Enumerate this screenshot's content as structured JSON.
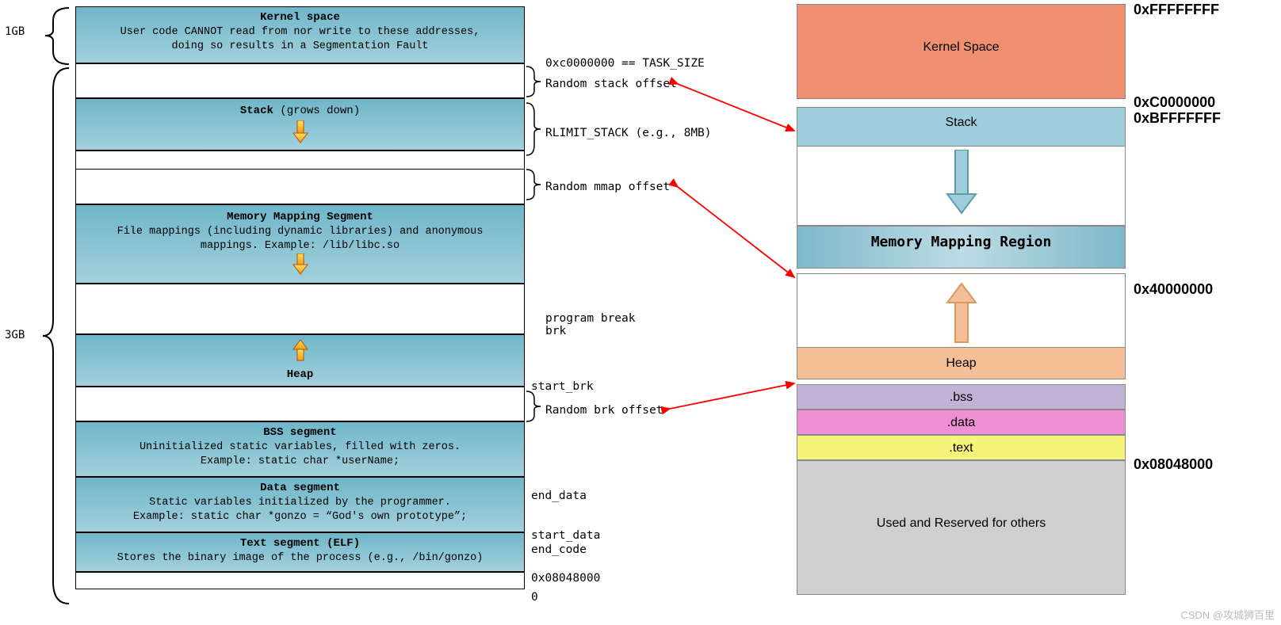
{
  "left": {
    "size_1gb": "1GB",
    "size_3gb": "3GB",
    "kernel": {
      "title": "Kernel space",
      "sub": "User code CANNOT read from nor write to these addresses,\ndoing so results in a Segmentation Fault"
    },
    "stack": {
      "title": "Stack",
      "grows": " (grows down)"
    },
    "mmap": {
      "title": "Memory Mapping Segment",
      "sub": "File mappings (including dynamic libraries) and anonymous\nmappings. Example: /lib/libc.so"
    },
    "heap": {
      "title": "Heap"
    },
    "bss": {
      "title": "BSS segment",
      "sub": "Uninitialized static variables, filled with zeros.\nExample: static char *userName;"
    },
    "data": {
      "title": "Data segment",
      "sub": "Static variables initialized by the programmer.\nExample: static char *gonzo = “God's own prototype”;"
    },
    "text": {
      "title": "Text segment (ELF)",
      "sub": "Stores the binary image of the process (e.g., /bin/gonzo)"
    },
    "annot": {
      "task_size": "0xc0000000 == TASK_SIZE",
      "rand_stack": "Random stack offset",
      "rlimit": "RLIMIT_STACK (e.g., 8MB)",
      "rand_mmap": "Random mmap offset",
      "prog_break": "program break\nbrk",
      "start_brk": "start_brk",
      "rand_brk": "Random brk offset",
      "end_data": "end_data",
      "start_data": "start_data",
      "end_code": "end_code",
      "addr_text": "0x08048000",
      "zero": "0"
    }
  },
  "right": {
    "kernel": "Kernel Space",
    "stack": "Stack",
    "mmap": "Memory Mapping Region",
    "heap": "Heap",
    "bss": ".bss",
    "data": ".data",
    "text": ".text",
    "reserved": "Used and Reserved for others",
    "addr": {
      "ffff": "0xFFFFFFFF",
      "c000": "0xC0000000",
      "bfff": "0xBFFFFFFF",
      "x4000": "0x40000000",
      "x0804": "0x08048000"
    }
  },
  "watermark": "CSDN @攻城狮百里"
}
